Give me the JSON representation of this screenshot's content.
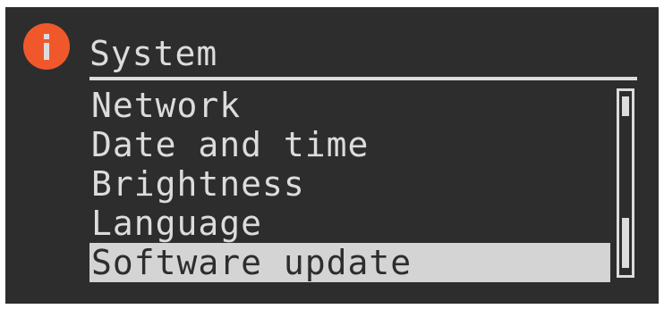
{
  "header": {
    "icon": "info-icon",
    "title": "System"
  },
  "menu": {
    "items": [
      {
        "label": "Network",
        "selected": false
      },
      {
        "label": "Date and time",
        "selected": false
      },
      {
        "label": "Brightness",
        "selected": false
      },
      {
        "label": "Language",
        "selected": false
      },
      {
        "label": "Software update",
        "selected": true
      }
    ]
  },
  "colors": {
    "background": "#2d2d2d",
    "foreground": "#dcdcdc",
    "icon_accent": "#f0582c",
    "selection": "#d4d4d4"
  }
}
